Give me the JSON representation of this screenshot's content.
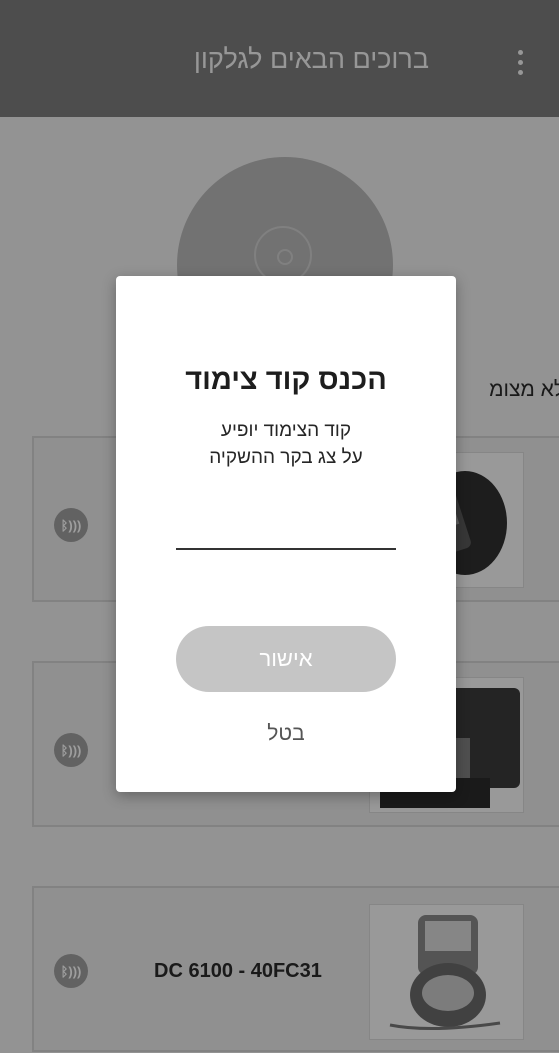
{
  "app_bar": {
    "title": "ברוכים הבאים לגלקון",
    "menu_icon": "more-vert-icon"
  },
  "hero": {
    "icon": "target-icon"
  },
  "section": {
    "label": "לא מצומ"
  },
  "devices": [
    {
      "name": "",
      "bluetooth_icon": "bluetooth-icon",
      "bluetooth_label": "ᛒ)))"
    },
    {
      "name": "",
      "bluetooth_icon": "bluetooth-icon",
      "bluetooth_label": "ᛒ)))"
    },
    {
      "name": "DC 6100 - 40FC31",
      "bluetooth_icon": "bluetooth-icon",
      "bluetooth_label": "ᛒ)))"
    }
  ],
  "dialog": {
    "title": "הכנס קוד צימוד",
    "message_line1": "קוד הצימוד יופיע",
    "message_line2": "על צג בקר ההשקיה",
    "input_value": "",
    "input_placeholder": "",
    "confirm_label": "אישור",
    "cancel_label": "בטל"
  },
  "colors": {
    "app_bar": "#7d7d7d",
    "confirm_disabled": "#c5c5c5",
    "dialog_bg": "#ffffff"
  }
}
